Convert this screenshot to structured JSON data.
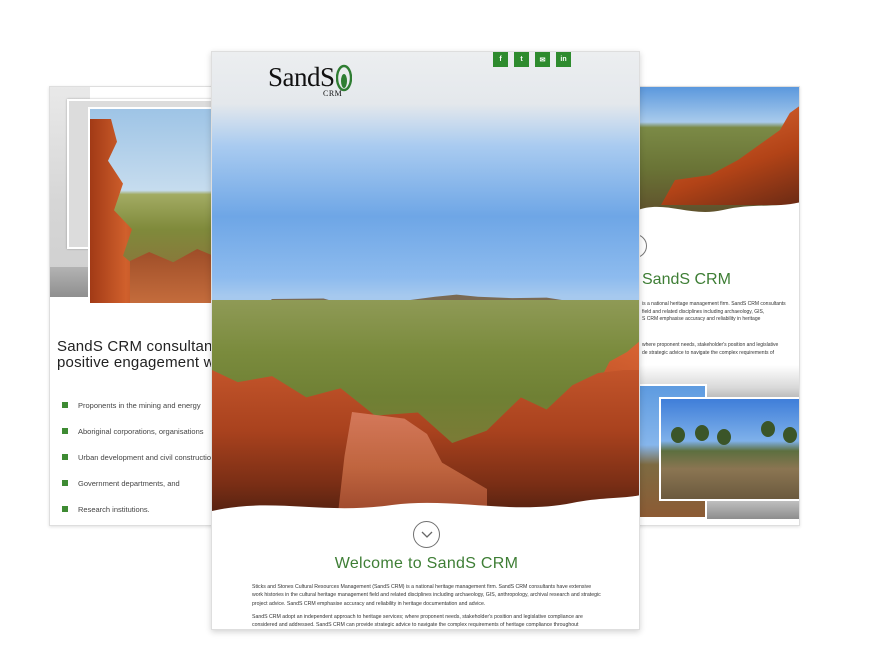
{
  "colors": {
    "accent_green": "#3e7e35",
    "social_green": "#2e8b2e",
    "bullet_green": "#3e8b33"
  },
  "center": {
    "logo": {
      "word": "SandS",
      "sub": "CRM"
    },
    "social": [
      {
        "icon": "facebook-icon",
        "glyph": "f"
      },
      {
        "icon": "twitter-icon",
        "glyph": "t"
      },
      {
        "icon": "mail-icon",
        "glyph": "✉"
      },
      {
        "icon": "linkedin-icon",
        "glyph": "in"
      }
    ],
    "welcome": "Welcome to SandS CRM",
    "intro_1": "Sticks and Stones Cultural Resources Management (SandS CRM) is a national heritage management firm. SandS CRM consultants have extensive work histories in the cultural heritage management field and related disciplines including archaeology, GIS, anthropology, archival research and strategic project advice. SandS CRM emphasise accuracy and reliability in heritage documentation and advice.",
    "intro_2": "SandS CRM adopt an independent approach to heritage services; where proponent needs, stakeholder's position and legislative compliance are considered and addressed. SandS CRM can provide strategic advice to navigate the complex requirements of heritage compliance throughout"
  },
  "left": {
    "heading": "SandS CRM consultants and positive engagement with:",
    "items": [
      "Proponents in the mining and energy",
      "Aboriginal corporations, organisations",
      "Urban development and civil construction",
      "Government departments, and",
      "Research institutions."
    ]
  },
  "right": {
    "title": "SandS CRM",
    "para_1_lines": [
      "is a national heritage management firm. SandS CRM consultants",
      "field and related disciplines including archaeology, GIS,",
      "S CRM emphasise accuracy and reliability in heritage"
    ],
    "para_2_lines": [
      "where proponent needs, stakeholder's position and legislative",
      "de strategic advice to navigate the complex requirements of"
    ]
  }
}
